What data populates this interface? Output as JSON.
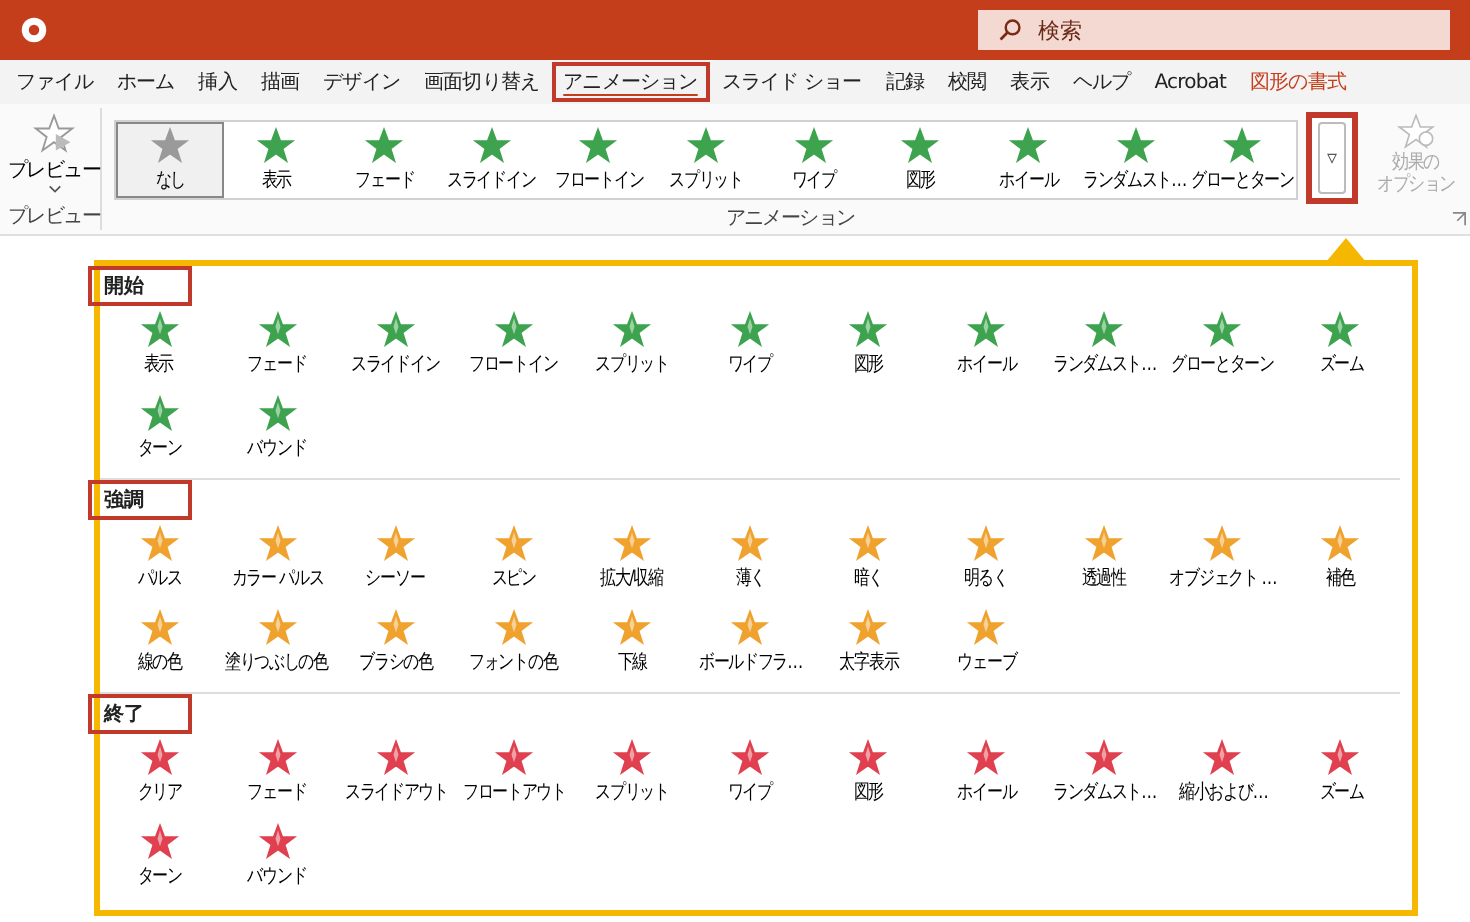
{
  "title_bar": {
    "search": {
      "placeholder": "検索"
    }
  },
  "tabs": [
    {
      "label": "ファイル",
      "selected": false,
      "contextual": false,
      "highlighted": false
    },
    {
      "label": "ホーム",
      "selected": false,
      "contextual": false,
      "highlighted": false
    },
    {
      "label": "挿入",
      "selected": false,
      "contextual": false,
      "highlighted": false
    },
    {
      "label": "描画",
      "selected": false,
      "contextual": false,
      "highlighted": false
    },
    {
      "label": "デザイン",
      "selected": false,
      "contextual": false,
      "highlighted": false
    },
    {
      "label": "画面切り替え",
      "selected": false,
      "contextual": false,
      "highlighted": false
    },
    {
      "label": "アニメーション",
      "selected": true,
      "contextual": false,
      "highlighted": true
    },
    {
      "label": "スライド ショー",
      "selected": false,
      "contextual": false,
      "highlighted": false
    },
    {
      "label": "記録",
      "selected": false,
      "contextual": false,
      "highlighted": false
    },
    {
      "label": "校閲",
      "selected": false,
      "contextual": false,
      "highlighted": false
    },
    {
      "label": "表示",
      "selected": false,
      "contextual": false,
      "highlighted": false
    },
    {
      "label": "ヘルプ",
      "selected": false,
      "contextual": false,
      "highlighted": false
    },
    {
      "label": "Acrobat",
      "selected": false,
      "contextual": false,
      "highlighted": false
    },
    {
      "label": "図形の書式",
      "selected": false,
      "contextual": true,
      "highlighted": false
    }
  ],
  "ribbon": {
    "preview": {
      "label": "プレビュー",
      "group_label": "プレビュー"
    },
    "gallery": {
      "group_label": "アニメーション",
      "items": [
        {
          "label": "なし",
          "selected": true,
          "color": "#9a9a9a"
        },
        {
          "label": "表示",
          "selected": false,
          "color": "#3ea34f"
        },
        {
          "label": "フェード",
          "selected": false,
          "color": "#3ea34f"
        },
        {
          "label": "スライドイン",
          "selected": false,
          "color": "#3ea34f"
        },
        {
          "label": "フロートイン",
          "selected": false,
          "color": "#3ea34f"
        },
        {
          "label": "スプリット",
          "selected": false,
          "color": "#3ea34f"
        },
        {
          "label": "ワイプ",
          "selected": false,
          "color": "#3ea34f"
        },
        {
          "label": "図形",
          "selected": false,
          "color": "#3ea34f"
        },
        {
          "label": "ホイール",
          "selected": false,
          "color": "#3ea34f"
        },
        {
          "label": "ランダムスト…",
          "selected": false,
          "color": "#3ea34f"
        },
        {
          "label": "グローとターン",
          "selected": false,
          "color": "#3ea34f"
        }
      ]
    },
    "more_button": {
      "label": "▿",
      "highlighted": true
    },
    "effect_options": {
      "label_lines": [
        "効果の",
        "オプション"
      ],
      "disabled": true
    }
  },
  "panel": {
    "sections": [
      {
        "title": "開始",
        "highlighted": true,
        "color": "#3ea34f",
        "items": [
          "表示",
          "フェード",
          "スライドイン",
          "フロートイン",
          "スプリット",
          "ワイプ",
          "図形",
          "ホイール",
          "ランダムスト…",
          "グローとターン",
          "ズーム",
          "ターン",
          "バウンド"
        ]
      },
      {
        "title": "強調",
        "highlighted": true,
        "color": "#f0a22e",
        "items": [
          "パルス",
          "カラー パルス",
          "シーソー",
          "スピン",
          "拡大/収縮",
          "薄く",
          "暗く",
          "明るく",
          "透過性",
          "オブジェクト …",
          "補色",
          "線の色",
          "塗りつぶしの色",
          "ブラシの色",
          "フォントの色",
          "下線",
          "ボールドフラ…",
          "太字表示",
          "ウェーブ"
        ]
      },
      {
        "title": "終了",
        "highlighted": true,
        "color": "#e0404f",
        "items": [
          "クリア",
          "フェード",
          "スライドアウト",
          "フロートアウト",
          "スプリット",
          "ワイプ",
          "図形",
          "ホイール",
          "ランダムスト…",
          "縮小および…",
          "ズーム",
          "ターン",
          "バウンド"
        ]
      }
    ]
  }
}
